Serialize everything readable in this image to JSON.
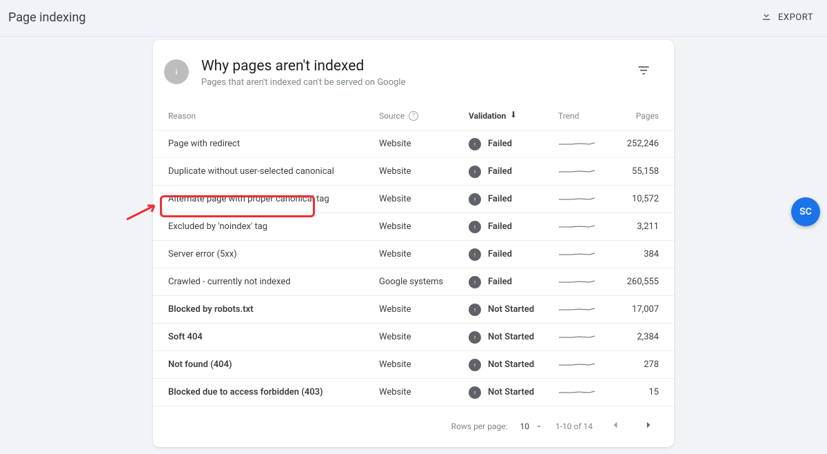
{
  "header": {
    "title": "Page indexing",
    "export_label": "EXPORT"
  },
  "card": {
    "title": "Why pages aren't indexed",
    "subtitle": "Pages that aren't indexed can't be served on Google"
  },
  "columns": {
    "reason": "Reason",
    "source": "Source",
    "validation": "Validation",
    "trend": "Trend",
    "pages": "Pages"
  },
  "rows": [
    {
      "reason": "Page with redirect",
      "source": "Website",
      "validation": "Failed",
      "pages": "252,246",
      "bold": false
    },
    {
      "reason": "Duplicate without user-selected canonical",
      "source": "Website",
      "validation": "Failed",
      "pages": "55,158",
      "bold": false
    },
    {
      "reason": "Alternate page with proper canonical tag",
      "source": "Website",
      "validation": "Failed",
      "pages": "10,572",
      "bold": false
    },
    {
      "reason": "Excluded by 'noindex' tag",
      "source": "Website",
      "validation": "Failed",
      "pages": "3,211",
      "bold": false
    },
    {
      "reason": "Server error (5xx)",
      "source": "Website",
      "validation": "Failed",
      "pages": "384",
      "bold": false
    },
    {
      "reason": "Crawled - currently not indexed",
      "source": "Google systems",
      "validation": "Failed",
      "pages": "260,555",
      "bold": false
    },
    {
      "reason": "Blocked by robots.txt",
      "source": "Website",
      "validation": "Not Started",
      "pages": "17,007",
      "bold": true
    },
    {
      "reason": "Soft 404",
      "source": "Website",
      "validation": "Not Started",
      "pages": "2,384",
      "bold": true
    },
    {
      "reason": "Not found (404)",
      "source": "Website",
      "validation": "Not Started",
      "pages": "278",
      "bold": true
    },
    {
      "reason": "Blocked due to access forbidden (403)",
      "source": "Website",
      "validation": "Not Started",
      "pages": "15",
      "bold": true
    }
  ],
  "footer": {
    "rows_per_page_label": "Rows per page:",
    "rows_per_page_value": "10",
    "range_label": "1-10 of 14"
  },
  "fab": {
    "initials": "SC"
  }
}
